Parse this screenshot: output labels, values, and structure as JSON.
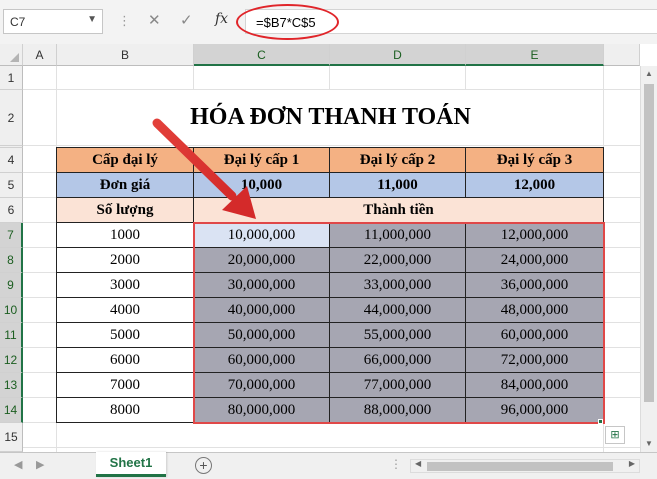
{
  "namebox": "C7",
  "formula": "=$B7*C$5",
  "columns": [
    "A",
    "B",
    "C",
    "D",
    "E"
  ],
  "rows": [
    "1",
    "2",
    "3",
    "4",
    "5",
    "6",
    "7",
    "8",
    "9",
    "10",
    "11",
    "12",
    "13",
    "14",
    "15"
  ],
  "table": {
    "title": "HÓA ĐƠN THANH TOÁN",
    "header": [
      "Cấp đại lý",
      "Đại lý cấp 1",
      "Đại lý cấp 2",
      "Đại lý cấp 3"
    ],
    "price_label": "Đơn giá",
    "prices": [
      "10,000",
      "11,000",
      "12,000"
    ],
    "qty_label": "Số lượng",
    "total_label": "Thành tiền",
    "data": [
      [
        "1000",
        "10,000,000",
        "11,000,000",
        "12,000,000"
      ],
      [
        "2000",
        "20,000,000",
        "22,000,000",
        "24,000,000"
      ],
      [
        "3000",
        "30,000,000",
        "33,000,000",
        "36,000,000"
      ],
      [
        "4000",
        "40,000,000",
        "44,000,000",
        "48,000,000"
      ],
      [
        "5000",
        "50,000,000",
        "55,000,000",
        "60,000,000"
      ],
      [
        "6000",
        "60,000,000",
        "66,000,000",
        "72,000,000"
      ],
      [
        "7000",
        "70,000,000",
        "77,000,000",
        "84,000,000"
      ],
      [
        "8000",
        "80,000,000",
        "88,000,000",
        "96,000,000"
      ]
    ]
  },
  "sheet_tab": "Sheet1",
  "colors": {
    "accent": "#217346",
    "annotation": "#e0252a",
    "header": "#f4b183",
    "price_row": "#b4c7e7",
    "label_row": "#fbe3d6",
    "selection_fill": "#a6a6b2"
  }
}
